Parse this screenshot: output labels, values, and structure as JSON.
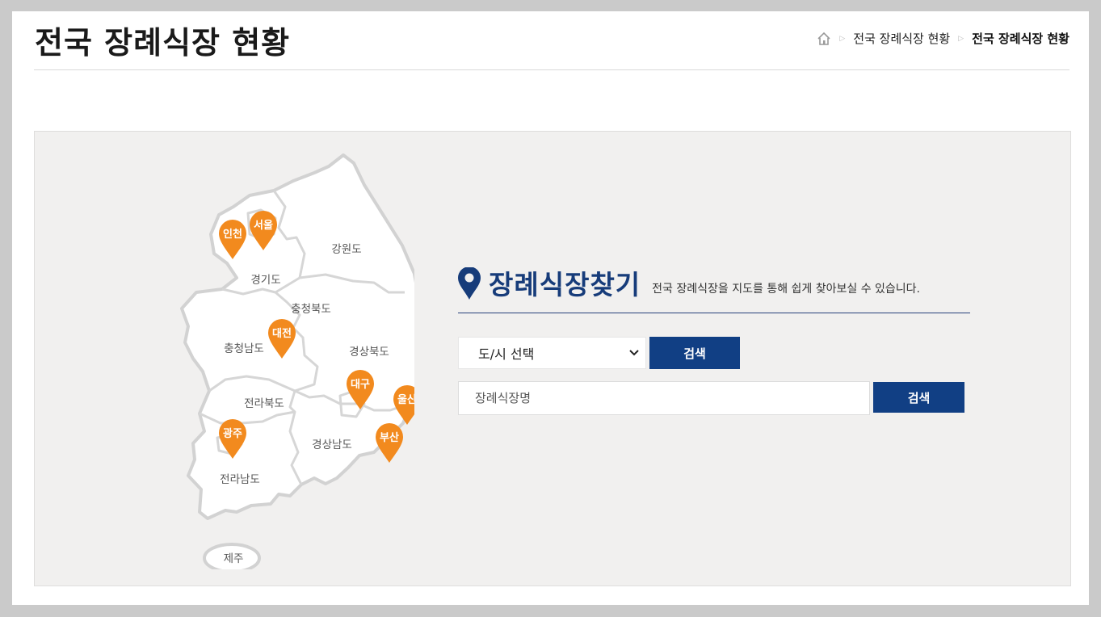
{
  "page": {
    "title": "전국 장례식장 현황"
  },
  "breadcrumb": {
    "home_icon": "home-icon",
    "items": [
      "전국 장례식장 현황",
      "전국 장례식장 현황"
    ]
  },
  "map": {
    "regions": {
      "gyeonggi": "경기도",
      "gangwon": "강원도",
      "chungbuk": "충청북도",
      "chungnam": "충청남도",
      "gyeongbuk": "경상북도",
      "jeonbuk": "전라북도",
      "gyeongnam": "경상남도",
      "jeonnam": "전라남도",
      "jeju": "제주"
    },
    "pins": {
      "incheon": "인천",
      "seoul": "서울",
      "daejeon": "대전",
      "daegu": "대구",
      "ulsan": "울산",
      "gwangju": "광주",
      "busan": "부산"
    },
    "pin_color": "#f28a1e"
  },
  "finder": {
    "icon": "location-pin-icon",
    "title": "장례식장찾기",
    "description": "전국 장례식장을 지도를 통해 쉽게 찾아보실 수 있습니다.",
    "region_select": {
      "value": "도/시 선택"
    },
    "search_label": "검색",
    "name_input": {
      "placeholder": "장례식장명"
    },
    "accent": "#113f84"
  }
}
